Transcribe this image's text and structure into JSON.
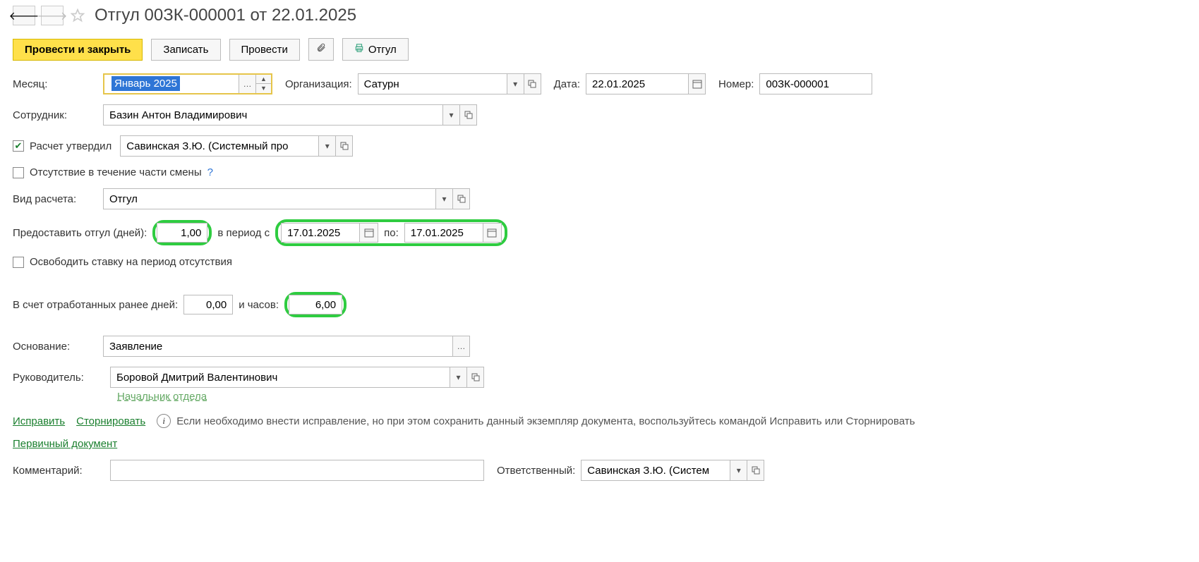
{
  "header": {
    "title": "Отгул 00ЗК-000001 от 22.01.2025"
  },
  "toolbar": {
    "post_close": "Провести и закрыть",
    "save": "Записать",
    "post": "Провести",
    "print": "Отгул"
  },
  "labels": {
    "month": "Месяц:",
    "org": "Организация:",
    "date": "Дата:",
    "number": "Номер:",
    "employee": "Сотрудник:",
    "approved": "Расчет утвердил",
    "partshift": "Отсутствие в течение части смены",
    "calc_type": "Вид расчета:",
    "days": "Предоставить отгул (дней):",
    "period_from": "в период с",
    "period_to": "по:",
    "release": "Освободить ставку на период отсутствия",
    "earned_days": "В счет отработанных ранее дней:",
    "and_hours": "и часов:",
    "basis": "Основание:",
    "manager": "Руководитель:",
    "manager_role": "Начальник отдела ",
    "fix": "Исправить",
    "storno": "Сторнировать",
    "info": "Если необходимо внести исправление, но при этом сохранить данный экземпляр документа, воспользуйтесь командой Исправить или Сторнировать",
    "primary_doc": "Первичный документ",
    "comment": "Комментарий:",
    "responsible": "Ответственный:"
  },
  "values": {
    "month": "Январь 2025",
    "org": "Сатурн",
    "date": "22.01.2025",
    "number": "00ЗК-000001",
    "employee": "Базин Антон Владимирович",
    "approved_by": "Савинская З.Ю. (Системный про",
    "calc_type": "Отгул",
    "days": "1,00",
    "date_from": "17.01.2025",
    "date_to": "17.01.2025",
    "earned_days": "0,00",
    "earned_hours": "6,00",
    "basis": "Заявление",
    "manager": "Боровой Дмитрий Валентинович",
    "comment": "",
    "responsible": "Савинская З.Ю. (Систем"
  },
  "checks": {
    "approved": true,
    "partshift": false,
    "release": false
  }
}
